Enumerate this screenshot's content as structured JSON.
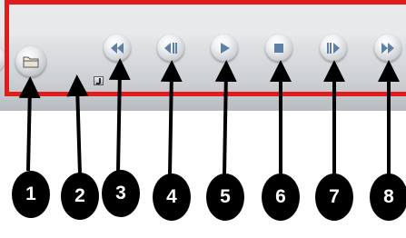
{
  "toolbar": {
    "buttons": [
      {
        "id": "open",
        "icon": "folder-icon"
      },
      {
        "id": "rewind",
        "icon": "rewind-icon"
      },
      {
        "id": "step-back",
        "icon": "step-back-icon"
      },
      {
        "id": "play",
        "icon": "play-icon"
      },
      {
        "id": "stop",
        "icon": "stop-icon"
      },
      {
        "id": "step-forward",
        "icon": "step-forward-icon"
      },
      {
        "id": "fast-forward",
        "icon": "fast-forward-icon"
      }
    ],
    "small_indicator_icon": "audio-indicator-icon",
    "highlight_color": "#e01c1c"
  },
  "callouts": [
    "1",
    "2",
    "3",
    "4",
    "5",
    "6",
    "7",
    "8"
  ],
  "colors": {
    "icon_blue": "#5e7fa6",
    "callout_bg": "#000000",
    "callout_text": "#ffffff"
  }
}
